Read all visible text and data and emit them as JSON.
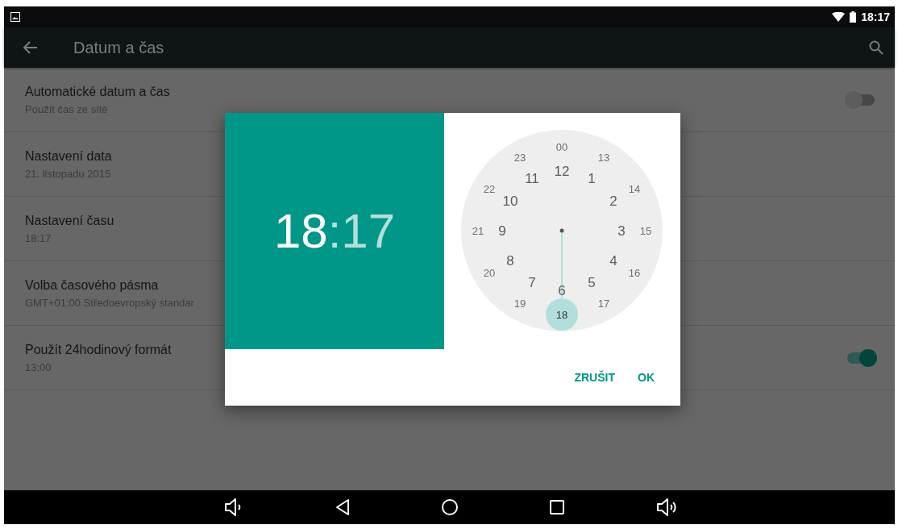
{
  "status_bar": {
    "time": "18:17"
  },
  "toolbar": {
    "title": "Datum a čas"
  },
  "settings": [
    {
      "kind": "switch",
      "title": "Automatické datum a čas",
      "subtitle": "Použít čas ze sítě",
      "on": false
    },
    {
      "kind": "plain",
      "title": "Nastavení data",
      "subtitle": "21. listopadu 2015"
    },
    {
      "kind": "plain",
      "title": "Nastavení času",
      "subtitle": "18:17"
    },
    {
      "kind": "plain",
      "title": "Volba časového pásma",
      "subtitle": "GMT+01:00 Středoevropský standar"
    },
    {
      "kind": "switch",
      "title": "Použít 24hodinový formát",
      "subtitle": "13:00",
      "on": true
    }
  ],
  "dialog": {
    "header": [
      {
        "kind": "hour",
        "text": "18",
        "selected": true
      },
      {
        "kind": "separator",
        "text": ":"
      },
      {
        "kind": "minute",
        "text": "17",
        "selected": false
      }
    ],
    "clock": {
      "inner": [
        {
          "label": "12",
          "selected": false
        },
        {
          "label": "1",
          "selected": false
        },
        {
          "label": "2",
          "selected": false
        },
        {
          "label": "3",
          "selected": false
        },
        {
          "label": "4",
          "selected": false
        },
        {
          "label": "5",
          "selected": false
        },
        {
          "label": "6",
          "selected": false
        },
        {
          "label": "7",
          "selected": false
        },
        {
          "label": "8",
          "selected": false
        },
        {
          "label": "9",
          "selected": false
        },
        {
          "label": "10",
          "selected": false
        },
        {
          "label": "11",
          "selected": false
        }
      ],
      "outer": [
        {
          "label": "00",
          "selected": false
        },
        {
          "label": "13",
          "selected": false
        },
        {
          "label": "14",
          "selected": false
        },
        {
          "label": "15",
          "selected": false
        },
        {
          "label": "16",
          "selected": false
        },
        {
          "label": "17",
          "selected": false
        },
        {
          "label": "18",
          "selected": true
        },
        {
          "label": "19",
          "selected": false
        },
        {
          "label": "20",
          "selected": false
        },
        {
          "label": "21",
          "selected": false
        },
        {
          "label": "22",
          "selected": false
        },
        {
          "label": "23",
          "selected": false
        }
      ]
    },
    "buttons": [
      "ZRUŠIT",
      "OK"
    ]
  }
}
